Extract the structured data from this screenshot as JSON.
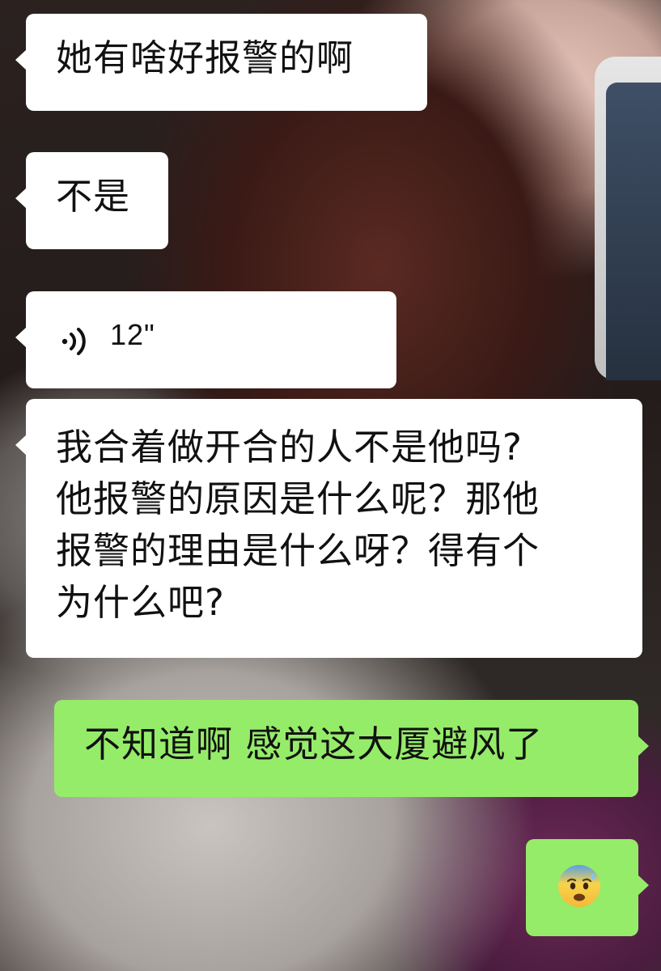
{
  "chat": {
    "messages": [
      {
        "side": "left",
        "type": "text",
        "text": "她有啥好报警的啊"
      },
      {
        "side": "left",
        "type": "text",
        "text": "不是"
      },
      {
        "side": "left",
        "type": "voice",
        "duration": "12\""
      },
      {
        "side": "left",
        "type": "text",
        "text": "我合着做开合的人不是他吗?\n他报警的原因是什么呢？那他\n报警的理由是什么呀？得有个\n为什么吧?"
      },
      {
        "side": "right",
        "type": "text",
        "text": "不知道啊 感觉这大厦避风了"
      },
      {
        "side": "right",
        "type": "emoji",
        "emoji_name": "anxious-face-with-sweat-icon"
      }
    ]
  },
  "colors": {
    "left_bubble": "#ffffff",
    "right_bubble": "#95ec69",
    "text": "#111111"
  }
}
